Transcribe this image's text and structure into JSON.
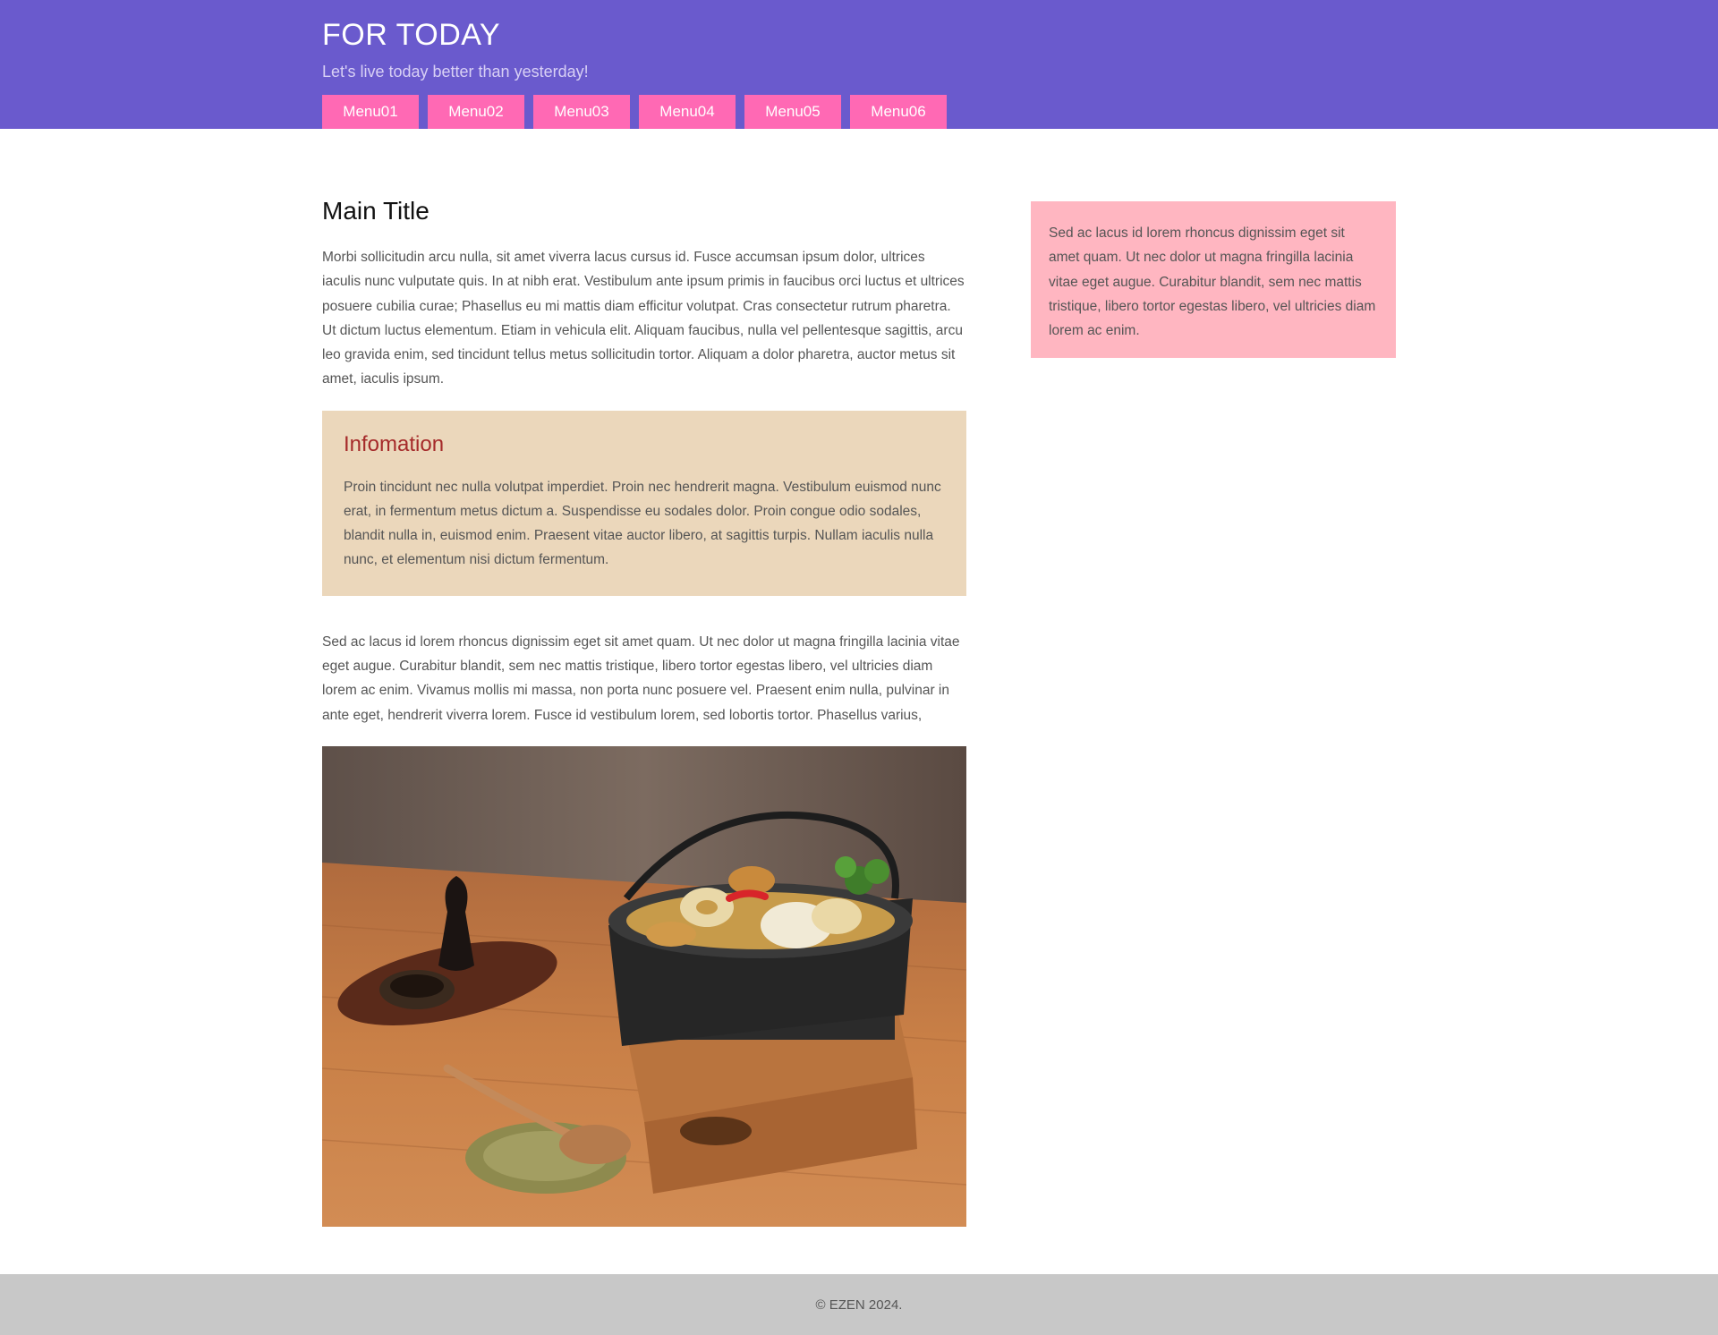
{
  "header": {
    "title": "FOR TODAY",
    "tagline": "Let's live today better than yesterday!",
    "menu": [
      "Menu01",
      "Menu02",
      "Menu03",
      "Menu04",
      "Menu05",
      "Menu06"
    ]
  },
  "main": {
    "title": "Main Title",
    "intro": "Morbi sollicitudin arcu nulla, sit amet viverra lacus cursus id. Fusce accumsan ipsum dolor, ultrices iaculis nunc vulputate quis. In at nibh erat. Vestibulum ante ipsum primis in faucibus orci luctus et ultrices posuere cubilia curae; Phasellus eu mi mattis diam efficitur volutpat. Cras consectetur rutrum pharetra. Ut dictum luctus elementum. Etiam in vehicula elit. Aliquam faucibus, nulla vel pellentesque sagittis, arcu leo gravida enim, sed tincidunt tellus metus sollicitudin tortor. Aliquam a dolor pharetra, auctor metus sit amet, iaculis ipsum.",
    "info": {
      "title": "Infomation",
      "text": "Proin tincidunt nec nulla volutpat imperdiet. Proin nec hendrerit magna. Vestibulum euismod nunc erat, in fermentum metus dictum a. Suspendisse eu sodales dolor. Proin congue odio sodales, blandit nulla in, euismod enim. Praesent vitae auctor libero, at sagittis turpis. Nullam iaculis nulla nunc, et elementum nisi dictum fermentum."
    },
    "body": "Sed ac lacus id lorem rhoncus dignissim eget sit amet quam. Ut nec dolor ut magna fringilla lacinia vitae eget augue. Curabitur blandit, sem nec mattis tristique, libero tortor egestas libero, vel ultricies diam lorem ac enim. Vivamus mollis mi massa, non porta nunc posuere vel. Praesent enim nulla, pulvinar in ante eget, hendrerit viverra lorem. Fusce id vestibulum lorem, sed lobortis tortor. Phasellus varius,"
  },
  "sidebar": {
    "text": "Sed ac lacus id lorem rhoncus dignissim eget sit amet quam. Ut nec dolor ut magna fringilla lacinia vitae eget augue. Curabitur blandit, sem nec mattis tristique, libero tortor egestas libero, vel ultricies diam lorem ac enim."
  },
  "footer": {
    "copyright": "© EZEN 2024."
  },
  "colors": {
    "header_bg": "#6a5acd",
    "menu_bg": "#ff69b4",
    "info_bg": "#ebd7bb",
    "info_title": "#a52a2a",
    "sidebar_bg": "#ffb6c1",
    "footer_bg": "#c8c8c8"
  }
}
